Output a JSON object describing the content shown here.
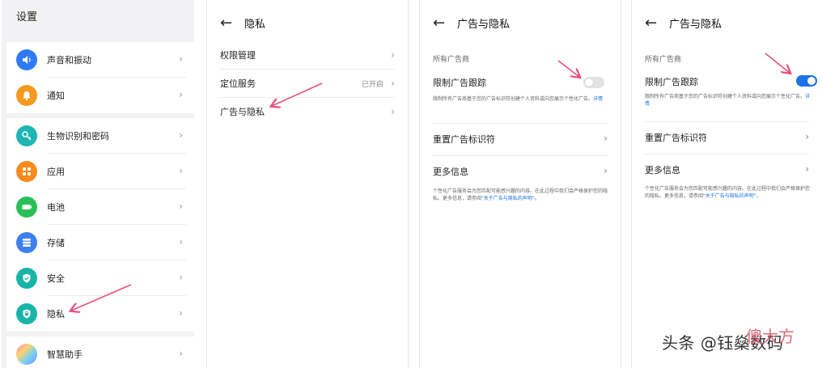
{
  "colors": {
    "accent": "#1a73e8",
    "arrow": "#e8507a",
    "sound": "#2f7bf6",
    "notify": "#f59a1e",
    "biometric": "#1fb5b5",
    "apps": "#f58a1e",
    "battery": "#2bbf5a",
    "storage": "#3d7ff0",
    "security": "#19b4a8",
    "privacy": "#19b4a8"
  },
  "settings": {
    "title": "设置",
    "items": [
      {
        "label": "声音和振动",
        "icon": "speaker-icon"
      },
      {
        "label": "通知",
        "icon": "bell-icon"
      },
      {
        "label": "生物识别和密码",
        "icon": "key-icon"
      },
      {
        "label": "应用",
        "icon": "apps-grid-icon"
      },
      {
        "label": "电池",
        "icon": "battery-icon"
      },
      {
        "label": "存储",
        "icon": "storage-icon"
      },
      {
        "label": "安全",
        "icon": "shield-check-icon"
      },
      {
        "label": "隐私",
        "icon": "privacy-lock-icon"
      },
      {
        "label": "智慧助手",
        "icon": "assistant-icon"
      }
    ]
  },
  "privacy": {
    "title": "隐私",
    "rows": [
      {
        "label": "权限管理",
        "value": ""
      },
      {
        "label": "定位服务",
        "value": "已开启"
      },
      {
        "label": "广告与隐私",
        "value": ""
      }
    ]
  },
  "ads_off": {
    "title": "广告与隐私",
    "section": "所有广告商",
    "limit_label": "限制广告跟踪",
    "limit_desc": "限制所有广告商基于您的广告标识符创建个人资料或向您展示个性化广告。",
    "details_link": "详情",
    "reset_label": "重置广告标识符",
    "more_label": "更多信息",
    "footer_text": "个性化广告服务会为您匹配可能感兴趣的内容。在此过程中我们会严格保护您的隐私。更多信息，请参阅",
    "footer_link": "\"关于广告与隐私的声明\"",
    "footer_end": "。",
    "toggle_state": "off"
  },
  "ads_on": {
    "title": "广告与隐私",
    "section": "所有广告商",
    "limit_label": "限制广告跟踪",
    "limit_desc": "限制所有广告商基于您的广告标识符创建个人资料或向您展示个性化广告。",
    "details_link": "详情",
    "reset_label": "重置广告标识符",
    "more_label": "更多信息",
    "footer_text": "个性化广告服务会为您匹配可能感兴趣的内容。在此过程中我们会严格保护您的隐私。更多信息，请参阅",
    "footer_link": "\"关于广告与隐私的声明\"",
    "footer_end": "。",
    "toggle_state": "on"
  },
  "watermark": {
    "text": "头条 @钰燊数码",
    "overlay": "傻大方"
  }
}
